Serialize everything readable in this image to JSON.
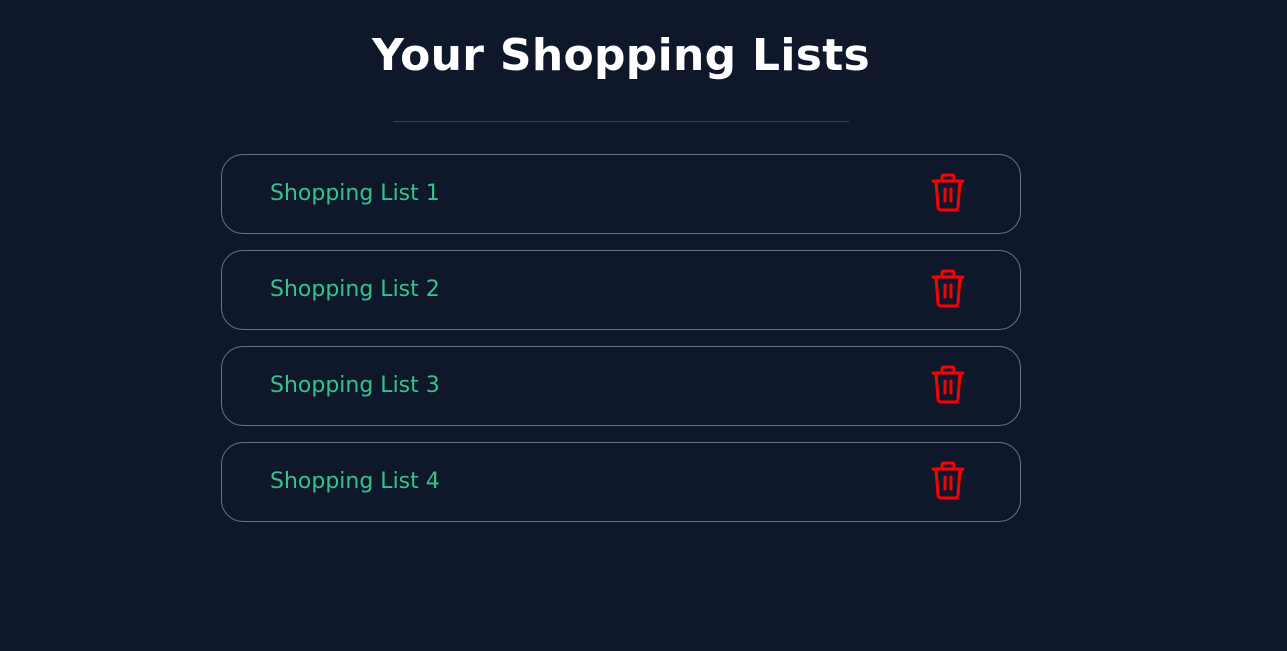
{
  "header": {
    "title": "Your Shopping Lists"
  },
  "lists": [
    {
      "name": "Shopping List 1",
      "action_icon": "trash-icon"
    },
    {
      "name": "Shopping List 2",
      "action_icon": "trash-icon"
    },
    {
      "name": "Shopping List 3",
      "action_icon": "trash-icon"
    },
    {
      "name": "Shopping List 4",
      "action_icon": "trash-icon"
    }
  ],
  "colors": {
    "background": "#0f172a",
    "title": "#ffffff",
    "list_text": "#34c48b",
    "delete_icon": "#ff0000",
    "border": "#6b7280"
  }
}
